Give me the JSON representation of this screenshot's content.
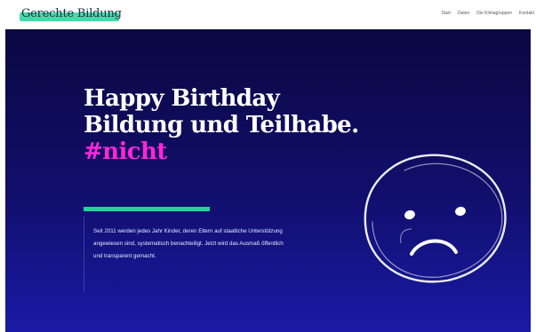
{
  "header": {
    "logo": "Gerechte Bildung",
    "nav": [
      "Start",
      "Daten",
      "Die Klimagruppen",
      "Kontakt"
    ]
  },
  "hero": {
    "title_line1": "Happy Birthday",
    "title_line2": "Bildung und Teilhabe.",
    "title_tag": "#nicht",
    "intro": "Seit 2011 werden jedes Jahr Kinder, deren Eltern auf staatliche Unterstützung angewiesen sind, systematisch benachteiligt. Jetzt wird das Ausmaß öffentlich und transparent gemacht."
  },
  "colors": {
    "accent_green": "#22d39b",
    "accent_magenta": "#ff26d9",
    "hero_dark": "#0b0742",
    "hero_light": "#1a1aa6"
  },
  "icons": {
    "hero_illustration": "sad-face-icon"
  }
}
